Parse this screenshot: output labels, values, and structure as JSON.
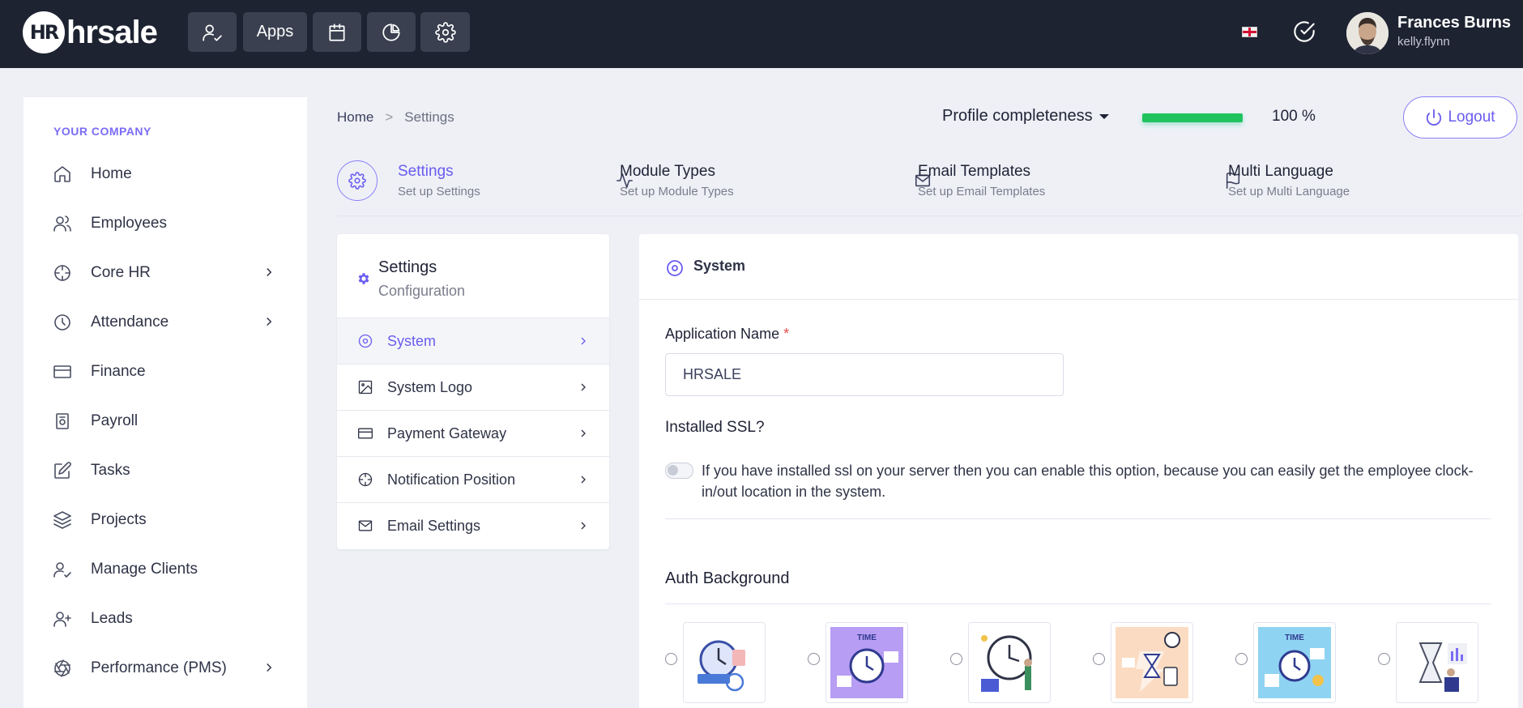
{
  "app": {
    "logo_mark": "HR",
    "logo_text": "hrsale"
  },
  "topbar": {
    "apps_label": "Apps",
    "user_name": "Frances Burns",
    "user_handle": "kelly.flynn",
    "flag": "uk-flag"
  },
  "sidebar": {
    "heading": "YOUR COMPANY",
    "items": [
      {
        "label": "Home",
        "icon": "home-icon",
        "has_children": false
      },
      {
        "label": "Employees",
        "icon": "users-icon",
        "has_children": false
      },
      {
        "label": "Core HR",
        "icon": "crosshair-icon",
        "has_children": true
      },
      {
        "label": "Attendance",
        "icon": "clock-icon",
        "has_children": true
      },
      {
        "label": "Finance",
        "icon": "credit-card-icon",
        "has_children": false
      },
      {
        "label": "Payroll",
        "icon": "payroll-icon",
        "has_children": false
      },
      {
        "label": "Tasks",
        "icon": "edit-icon",
        "has_children": false
      },
      {
        "label": "Projects",
        "icon": "layers-icon",
        "has_children": false
      },
      {
        "label": "Manage Clients",
        "icon": "user-check-icon",
        "has_children": false
      },
      {
        "label": "Leads",
        "icon": "user-plus-icon",
        "has_children": false
      },
      {
        "label": "Performance (PMS)",
        "icon": "aperture-icon",
        "has_children": true
      }
    ]
  },
  "breadcrumb": {
    "home": "Home",
    "separator": ">",
    "current": "Settings"
  },
  "profile": {
    "label": "Profile completeness",
    "percent": 100,
    "percent_text": "100 %",
    "bar_color": "#20c35e"
  },
  "logout_label": "Logout",
  "tabs": [
    {
      "title": "Settings",
      "subtitle": "Set up Settings",
      "icon": "gear-icon",
      "active": true
    },
    {
      "title": "Module Types",
      "subtitle": "Set up Module Types",
      "icon": "activity-icon",
      "active": false
    },
    {
      "title": "Email Templates",
      "subtitle": "Set up Email Templates",
      "icon": "mail-icon",
      "active": false
    },
    {
      "title": "Multi Language",
      "subtitle": "Set up Multi Language",
      "icon": "flag-icon",
      "active": false
    }
  ],
  "config": {
    "title": "Settings",
    "subtitle": "Configuration",
    "items": [
      {
        "label": "System",
        "icon": "disc-icon",
        "active": true
      },
      {
        "label": "System Logo",
        "icon": "image-icon",
        "active": false
      },
      {
        "label": "Payment Gateway",
        "icon": "credit-card-icon",
        "active": false
      },
      {
        "label": "Notification Position",
        "icon": "crosshair-icon",
        "active": false
      },
      {
        "label": "Email Settings",
        "icon": "mail-icon",
        "active": false
      }
    ]
  },
  "system": {
    "title": "System",
    "app_name_label": "Application Name",
    "required_mark": "*",
    "app_name_value": "HRSALE",
    "ssl_label": "Installed SSL?",
    "ssl_enabled": false,
    "ssl_help": "If you have installed ssl on your server then you can enable this option, because you can easily get the employee clock-in/out location in the system.",
    "auth_bg_label": "Auth Background",
    "auth_bg_thumb_text": "TIME"
  },
  "colors": {
    "accent": "#6a5cf0",
    "topbar": "#1d2331",
    "page_bg": "#eef0f6",
    "success": "#20c35e"
  }
}
